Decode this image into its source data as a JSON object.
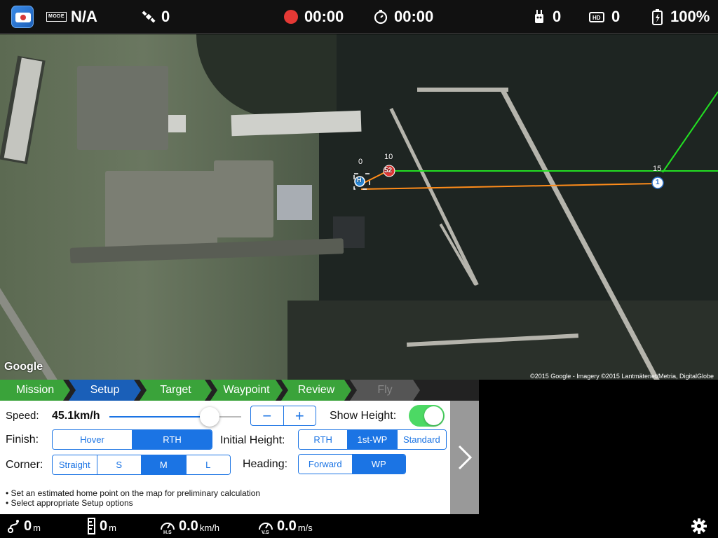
{
  "status_bar": {
    "mode_badge": "MODE",
    "mode_value": "N/A",
    "satellites": "0",
    "record_time": "00:00",
    "flight_time": "00:00",
    "remote_signal": "0",
    "video_signal": "0",
    "battery": "100%",
    "battery_label": "HD"
  },
  "map": {
    "logo": "Google",
    "attribution": "©2015 Google - Imagery ©2015 Lantmäteriet/Metria, DigitalGlobe",
    "home_marker": "H",
    "waypoints": [
      {
        "index": "0",
        "label": "0"
      },
      {
        "index": "10",
        "label": "10",
        "badge": "52"
      },
      {
        "index": "15",
        "label": "15",
        "badge": "1"
      }
    ],
    "route_colors": {
      "green": "#22e022",
      "orange": "#ff8c1a"
    }
  },
  "tabs": [
    {
      "label": "Mission",
      "state": "done"
    },
    {
      "label": "Setup",
      "state": "active"
    },
    {
      "label": "Target",
      "state": "done"
    },
    {
      "label": "Waypoint",
      "state": "done"
    },
    {
      "label": "Review",
      "state": "done"
    },
    {
      "label": "Fly",
      "state": "disabled"
    }
  ],
  "setup": {
    "speed_label": "Speed:",
    "speed_value": "45.1km/h",
    "speed_fraction": 0.76,
    "stepper_minus": "−",
    "stepper_plus": "+",
    "show_height_label": "Show Height:",
    "show_height_on": true,
    "finish_label": "Finish:",
    "finish_options": [
      "Hover",
      "RTH"
    ],
    "finish_selected": "RTH",
    "initial_height_label": "Initial Height:",
    "initial_height_options": [
      "RTH",
      "1st-WP",
      "Standard"
    ],
    "initial_height_selected": "1st-WP",
    "corner_label": "Corner:",
    "corner_options": [
      "Straight",
      "S",
      "M",
      "L"
    ],
    "corner_selected": "M",
    "heading_label": "Heading:",
    "heading_options": [
      "Forward",
      "WP"
    ],
    "heading_selected": "WP",
    "hints": [
      "• Set an estimated home point on the map for preliminary calculation",
      "• Select appropriate Setup options"
    ]
  },
  "telemetry": {
    "distance_value": "0",
    "distance_unit": "m",
    "height_value": "0",
    "height_unit": "m",
    "hspeed_value": "0.0",
    "hspeed_unit": "km/h",
    "vspeed_value": "0.0",
    "vspeed_unit": "m/s"
  },
  "colors": {
    "accent": "#1b74e4",
    "tab_green": "#3aa33a",
    "tab_active": "#1a5fb8",
    "toggle_on": "#4cd964",
    "record_dot": "#e53935"
  }
}
